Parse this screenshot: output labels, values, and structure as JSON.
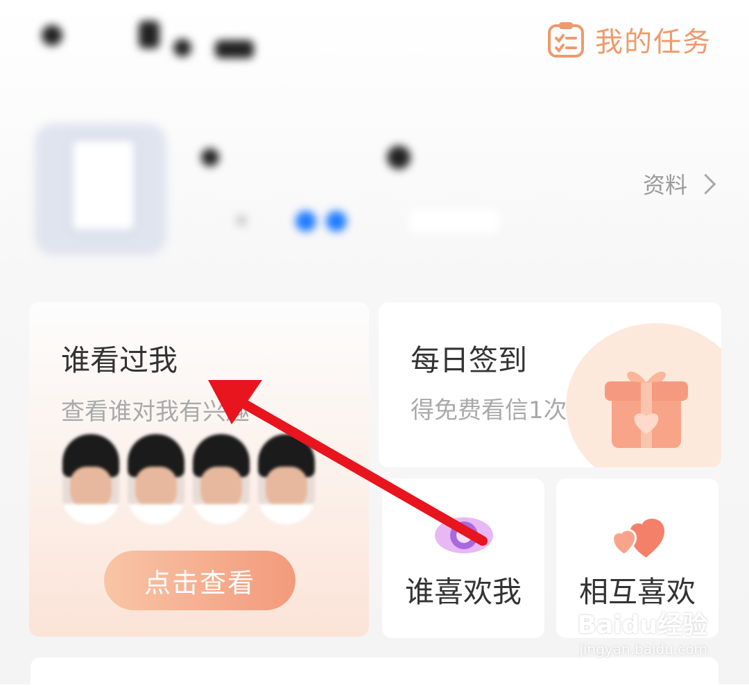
{
  "header": {
    "task_label": "我的任务"
  },
  "profile": {
    "link_label": "资料"
  },
  "visitors_card": {
    "title": "谁看过我",
    "subtitle": "查看谁对我有兴趣",
    "button_label": "点击查看"
  },
  "checkin_card": {
    "title": "每日签到",
    "subtitle": "得免费看信1次"
  },
  "likes_card": {
    "label": "谁喜欢我"
  },
  "mutual_card": {
    "label": "相互喜欢"
  },
  "watermark": {
    "brand": "Baidu经验",
    "url": "jingyan.baidu.com"
  },
  "colors": {
    "accent": "#ee9a6b",
    "button_start": "#f8c5a6",
    "button_end": "#f39a7c",
    "annotation_arrow": "#e8141e"
  }
}
